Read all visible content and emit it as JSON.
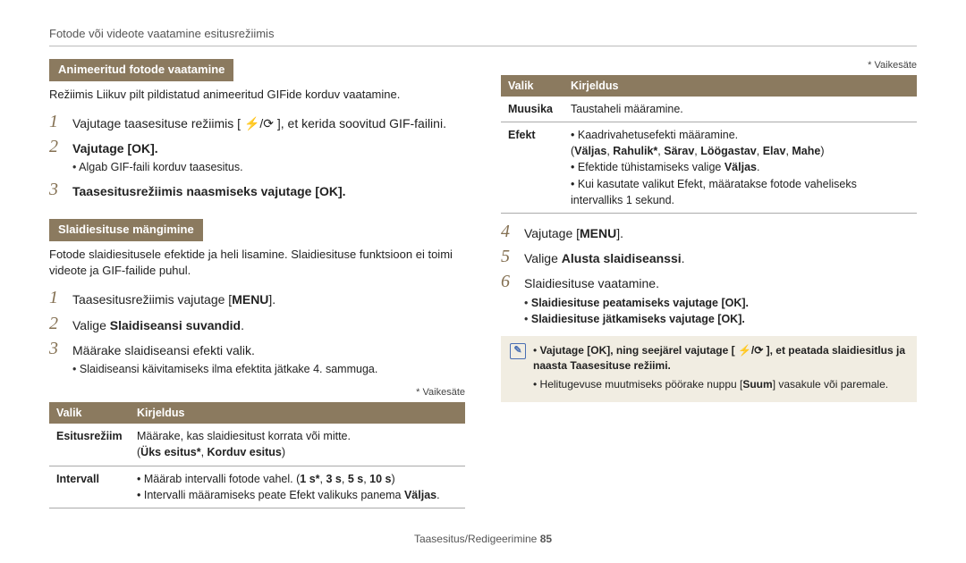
{
  "breadcrumb": "Fotode või videote vaatamine esitusrežiimis",
  "section1": {
    "title": "Animeeritud fotode vaatamine",
    "intro": "Režiimis Liikuv pilt pildistatud animeeritud GIFide korduv vaatamine.",
    "step1": "Vajutage taasesituse režiimis [ ⚡/⟳ ], et kerida soovitud GIF-failini.",
    "step2": "Vajutage [OK].",
    "step2_bullet": "Algab GIF-faili korduv taasesitus.",
    "step3": "Taasesitusrežiimis naasmiseks vajutage [OK]."
  },
  "section2": {
    "title": "Slaidiesituse mängimine",
    "intro": "Fotode slaidiesitusele efektide ja heli lisamine. Slaidiesituse funktsioon ei toimi videote ja GIF-failide puhul.",
    "step1_a": "Taasesitusrežiimis vajutage [",
    "step1_b": "MENU",
    "step1_c": "].",
    "step2_a": "Valige ",
    "step2_b": "Slaidiseansi suvandid",
    "step3": "Määrake slaidiseansi efekti valik.",
    "step3_bullet": "Slaidiseansi käivitamiseks ilma efektita jätkake 4. sammuga.",
    "default_note": "* Vaikesäte",
    "th1": "Valik",
    "th2": "Kirjeldus",
    "row1_k": "Esitusrežiim",
    "row1_v1": "Määrake, kas slaidiesitust korrata või mitte.",
    "row1_v2a": "(",
    "row1_v2b": "Üks esitus*",
    "row1_v2c": ", ",
    "row1_v2d": "Korduv esitus",
    "row1_v2e": ")",
    "row2_k": "Intervall",
    "row2_b1a": "Määrab intervalli fotode vahel. (",
    "row2_b1b": "1 s*",
    "row2_b1c": ", ",
    "row2_b1d": "3 s",
    "row2_b1e": ", ",
    "row2_b1f": "5 s",
    "row2_b1g": ", ",
    "row2_b1h": "10 s",
    "row2_b1i": ")",
    "row2_b2a": "Intervalli määramiseks peate Efekt valikuks panema ",
    "row2_b2b": "Väljas",
    "row2_b2c": "."
  },
  "right": {
    "default_note": "* Vaikesäte",
    "th1": "Valik",
    "th2": "Kirjeldus",
    "row1_k": "Muusika",
    "row1_v": "Taustaheli määramine.",
    "row2_k": "Efekt",
    "row2_b1": "Kaadrivahetusefekti määramine.",
    "row2_l1a": "(",
    "row2_l1b": "Väljas",
    "row2_l1c": ", ",
    "row2_l1d": "Rahulik*",
    "row2_l1e": ", ",
    "row2_l1f": "Särav",
    "row2_l1g": ", ",
    "row2_l1h": "Löögastav",
    "row2_l1i": ", ",
    "row2_l1j": "Elav",
    "row2_l1k": ", ",
    "row2_l1l": "Mahe",
    "row2_l1m": ")",
    "row2_b2a": "Efektide tühistamiseks valige ",
    "row2_b2b": "Väljas",
    "row2_b2c": ".",
    "row2_b3": "Kui kasutate valikut Efekt, määratakse fotode vaheliseks intervalliks 1 sekund.",
    "step4_a": "Vajutage [",
    "step4_b": "MENU",
    "step4_c": "].",
    "step5_a": "Valige ",
    "step5_b": "Alusta slaidiseanssi",
    "step5_c": ".",
    "step6": "Slaidiesituse vaatamine.",
    "step6_b1": "Slaidiesituse peatamiseks vajutage [OK].",
    "step6_b2": "Slaidiesituse jätkamiseks vajutage [OK].",
    "tip1": "Vajutage [OK], ning seejärel vajutage [ ⚡/⟳ ], et peatada slaidiesitlus ja naasta Taasesituse režiimi.",
    "tip2a": "Helitugevuse muutmiseks pöörake nuppu [",
    "tip2b": "Suum",
    "tip2c": "] vasakule või paremale."
  },
  "footer_a": "Taasesitus/Redigeerimine  ",
  "footer_b": "85"
}
